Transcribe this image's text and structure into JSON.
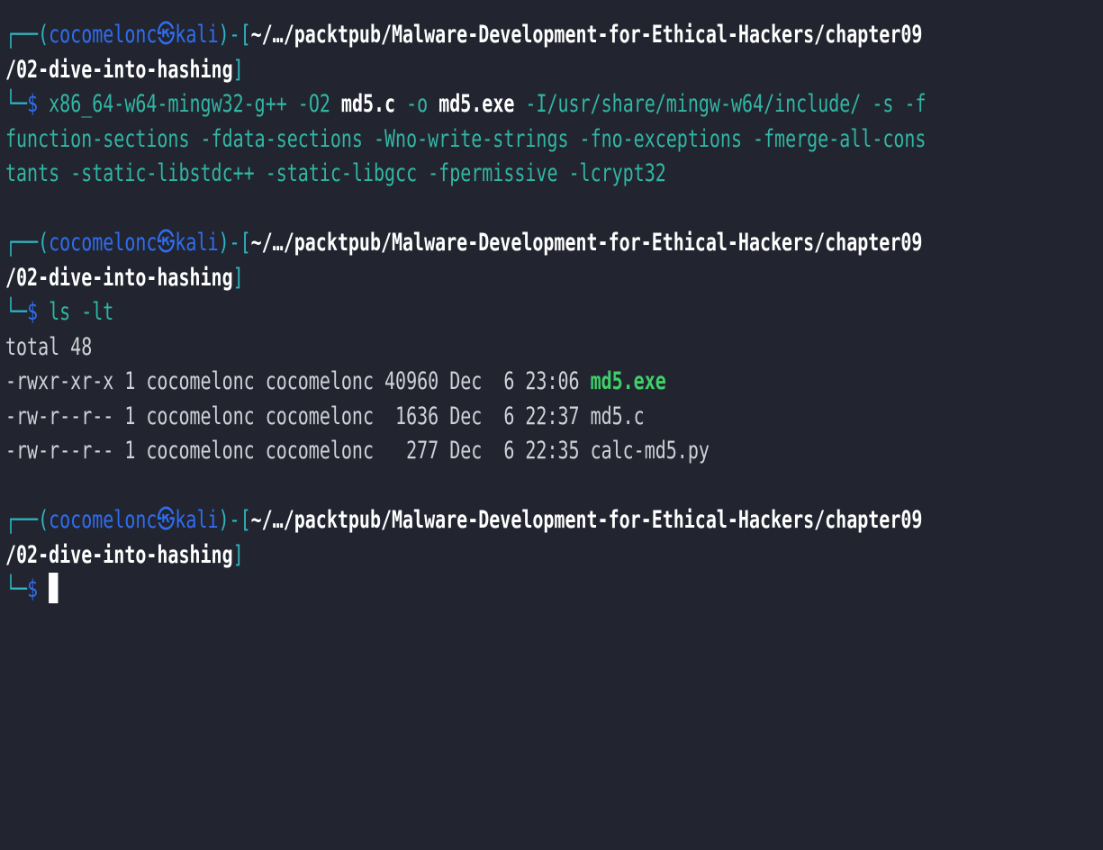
{
  "blocks": [
    {
      "user": "cocomelonc",
      "at": "㉿",
      "host": "kali",
      "path_line1": "~/…/packtpub/Malware-Development-for-Ethical-Hackers/chapter09",
      "path_line2": "/02-dive-into-hashing",
      "dollar": "$",
      "cmd_lines": [
        [
          {
            "t": "x86_64-w64-mingw32-g++ -O2 ",
            "c": "cmd"
          },
          {
            "t": "md5.c",
            "c": "bold-white"
          },
          {
            "t": " -o ",
            "c": "cmd"
          },
          {
            "t": "md5.exe",
            "c": "bold-white"
          },
          {
            "t": " -I/usr/share/mingw-w64/include/ -s -f",
            "c": "cmd"
          }
        ],
        [
          {
            "t": "function-sections -fdata-sections -Wno-write-strings -fno-exceptions -fmerge-all-cons",
            "c": "cmd"
          }
        ],
        [
          {
            "t": "tants -static-libstdc++ -static-libgcc -fpermissive -lcrypt32",
            "c": "cmd"
          }
        ]
      ]
    },
    {
      "user": "cocomelonc",
      "at": "㉿",
      "host": "kali",
      "path_line1": "~/…/packtpub/Malware-Development-for-Ethical-Hackers/chapter09",
      "path_line2": "/02-dive-into-hashing",
      "dollar": "$",
      "cmd_lines": [
        [
          {
            "t": "ls -lt",
            "c": "cmd"
          }
        ]
      ]
    },
    {
      "user": "cocomelonc",
      "at": "㉿",
      "host": "kali",
      "path_line1": "~/…/packtpub/Malware-Development-for-Ethical-Hackers/chapter09",
      "path_line2": "/02-dive-into-hashing",
      "dollar": "$",
      "cmd_lines": []
    }
  ],
  "ls_output": {
    "total": "total 48",
    "files": [
      {
        "perms": "-rwxr-xr-x",
        "links": "1",
        "owner": "cocomelonc",
        "group": "cocomelonc",
        "size": "40960",
        "month": "Dec",
        "day": "6",
        "time": "23:06",
        "name": "md5.exe",
        "style": "exe"
      },
      {
        "perms": "-rw-r--r--",
        "links": "1",
        "owner": "cocomelonc",
        "group": "cocomelonc",
        "size": "1636",
        "month": "Dec",
        "day": "6",
        "time": "22:37",
        "name": "md5.c",
        "style": "normal"
      },
      {
        "perms": "-rw-r--r--",
        "links": "1",
        "owner": "cocomelonc",
        "group": "cocomelonc",
        "size": "277",
        "month": "Dec",
        "day": "6",
        "time": "22:35",
        "name": "calc-md5.py",
        "style": "normal"
      }
    ]
  },
  "colors": {
    "background": "#22252f",
    "prompt_frame": "#2fb6c2",
    "user_host": "#2f6df0",
    "command": "#31b6a5",
    "executable": "#3fd06a",
    "text": "#cfd2d8"
  }
}
